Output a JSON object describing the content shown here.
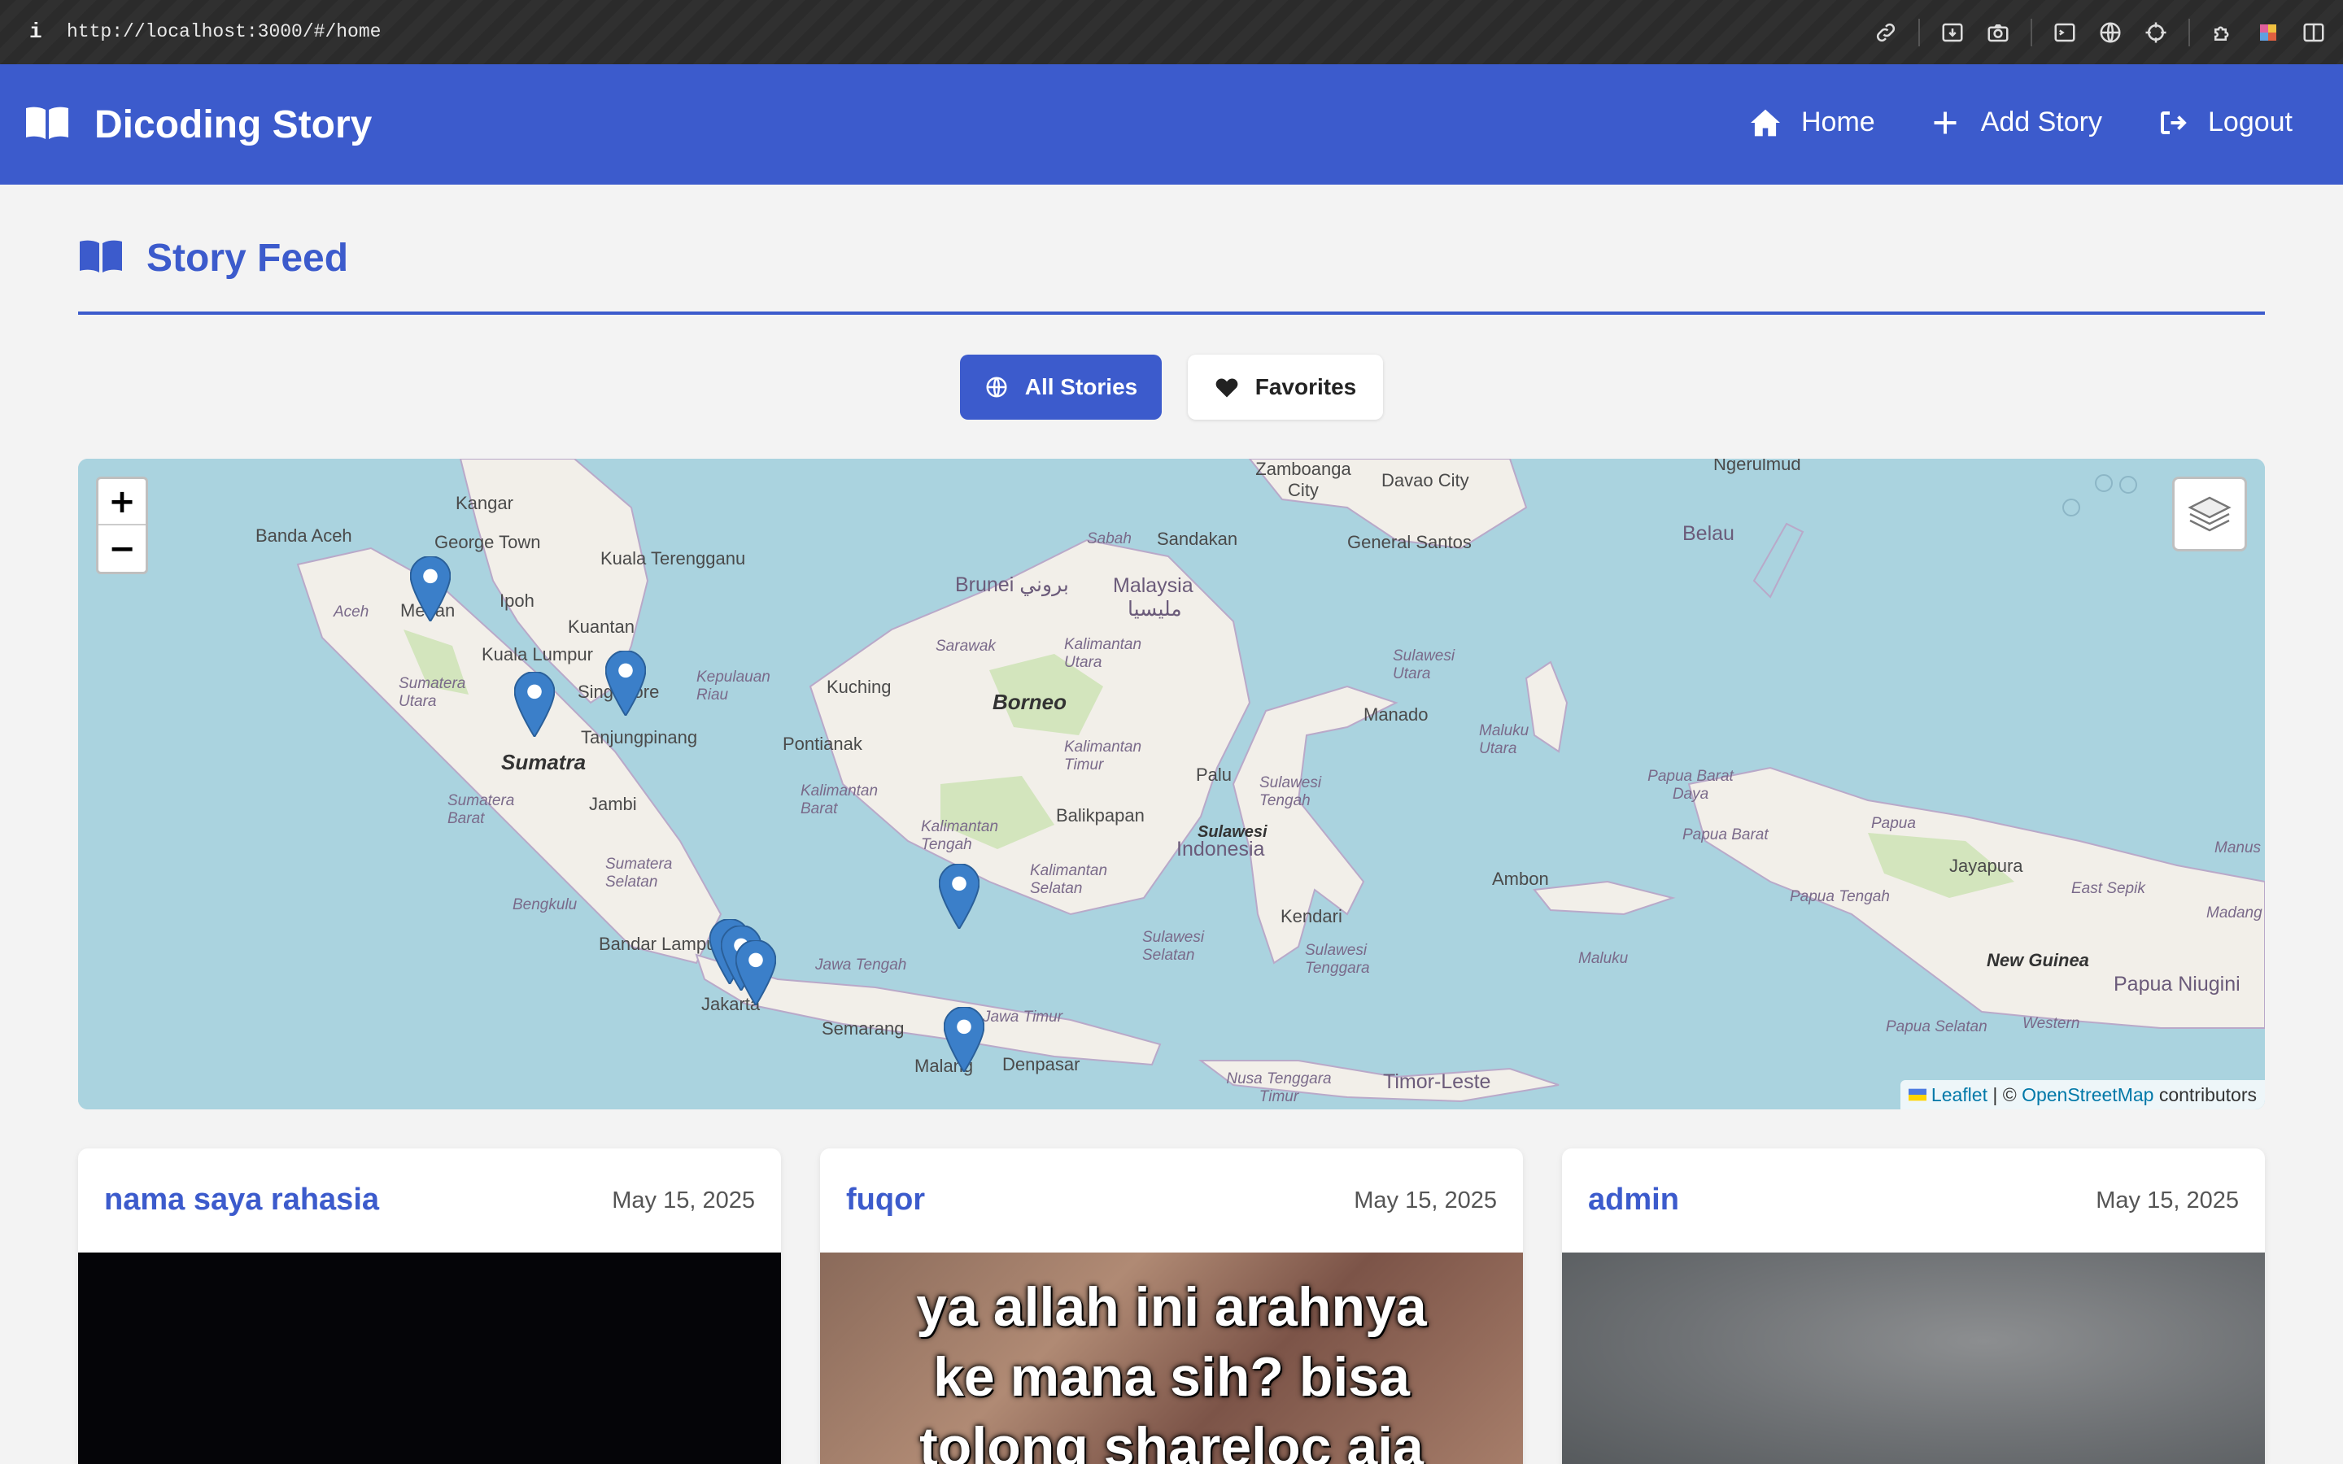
{
  "browser": {
    "info_glyph": "i",
    "url": "http://localhost:3000/#/home",
    "icons": [
      "link-icon",
      "download-icon",
      "camera-icon",
      "terminal-icon",
      "globe-icon",
      "crosshair-icon",
      "extensions-icon",
      "profile-icon",
      "sidebar-icon"
    ]
  },
  "navbar": {
    "brand_title": "Dicoding Story",
    "links": [
      {
        "label": "Home",
        "icon": "home-icon"
      },
      {
        "label": "Add Story",
        "icon": "plus-icon"
      },
      {
        "label": "Logout",
        "icon": "logout-icon"
      }
    ],
    "bg_color": "#3c5bcc"
  },
  "feed": {
    "title": "Story Feed",
    "filters": [
      {
        "label": "All Stories",
        "icon": "globe-icon",
        "active": true
      },
      {
        "label": "Favorites",
        "icon": "heart-icon",
        "active": false
      }
    ]
  },
  "map": {
    "zoom_in": "+",
    "zoom_out": "−",
    "attribution": {
      "leaflet": "Leaflet",
      "separator": " | © ",
      "osm": "OpenStreetMap",
      "suffix": " contributors"
    },
    "labels": {
      "kangar": "Kangar",
      "banda_aceh": "Banda Aceh",
      "george_town": "George Town",
      "kuala_terengganu": "Kuala Terengganu",
      "ipoh": "Ipoh",
      "medan": "Medan",
      "aceh": "Aceh",
      "kuantan": "Kuantan",
      "kuala_lumpur": "Kuala Lumpur",
      "singapore": "Singapore",
      "sumatera_utara": "Sumatera Utara",
      "kepulauan_riau": "Kepulauan Riau",
      "tanjungpinang": "Tanjungpinang",
      "sumatra": "Sumatra",
      "sumatera_barat": "Sumatera Barat",
      "jambi": "Jambi",
      "sumatera_selatan": "Sumatera Selatan",
      "bengkulu": "Bengkulu",
      "bandar_lampung": "Bandar Lampung",
      "jakarta": "Jakarta",
      "jawa_tengah": "Jawa Tengah",
      "semarang": "Semarang",
      "jawa_timur": "Jawa Timur",
      "malang": "Malang",
      "denpasar": "Denpasar",
      "zamboanga": "Zamboanga City",
      "davao": "Davao City",
      "general_santos": "General Santos",
      "ngerulmud": "Ngerulmud",
      "belau": "Belau",
      "sabah": "Sabah",
      "sandakan": "Sandakan",
      "brunei": "Brunei بروني",
      "malaysia": "Malaysia",
      "malaysia_jawi": "مليسيا",
      "sarawak": "Sarawak",
      "kuching": "Kuching",
      "kalimantan_utara": "Kalimantan Utara",
      "borneo": "Borneo",
      "pontianak": "Pontianak",
      "kalimantan_timur": "Kalimantan Timur",
      "kalimantan_barat": "Kalimantan Barat",
      "kalimantan_tengah": "Kalimantan Tengah",
      "balikpapan": "Balikpapan",
      "kalimantan_selatan": "Kalimantan Selatan",
      "sulawesi_utara": "Sulawesi Utara",
      "manado": "Manado",
      "palu": "Palu",
      "sulawesi_tengah": "Sulawesi Tengah",
      "sulawesi": "Sulawesi",
      "indonesia": "Indonesia",
      "maluku_utara": "Maluku Utara",
      "papua_barat_daya": "Papua Barat Daya",
      "papua": "Papua",
      "papua_barat": "Papua Barat",
      "jayapura": "Jayapura",
      "ambon": "Ambon",
      "kendari": "Kendari",
      "sulawesi_selatan": "Sulawesi Selatan",
      "sulawesi_tenggara": "Sulawesi Tenggara",
      "maluku": "Maluku",
      "papua_tengah": "Papua Tengah",
      "east_sepik": "East Sepik",
      "madang": "Madang",
      "manus": "Manus",
      "new_guinea": "New Guinea",
      "papua_niugini": "Papua Niugini",
      "papua_selatan": "Papua Selatan",
      "western": "Western",
      "nusa_tenggara_timur": "Nusa Tenggara Timur",
      "timor_leste": "Timor-Leste"
    },
    "marker_color": "#3b7fc9"
  },
  "stories": [
    {
      "author": "nama saya rahasia",
      "date": "May 15, 2025",
      "photo_caption": ""
    },
    {
      "author": "fuqor",
      "date": "May 15, 2025",
      "photo_caption": "ya allah ini arahnya ke mana sih? bisa tolong shareloc aja"
    },
    {
      "author": "admin",
      "date": "May 15, 2025",
      "photo_caption": ""
    }
  ]
}
